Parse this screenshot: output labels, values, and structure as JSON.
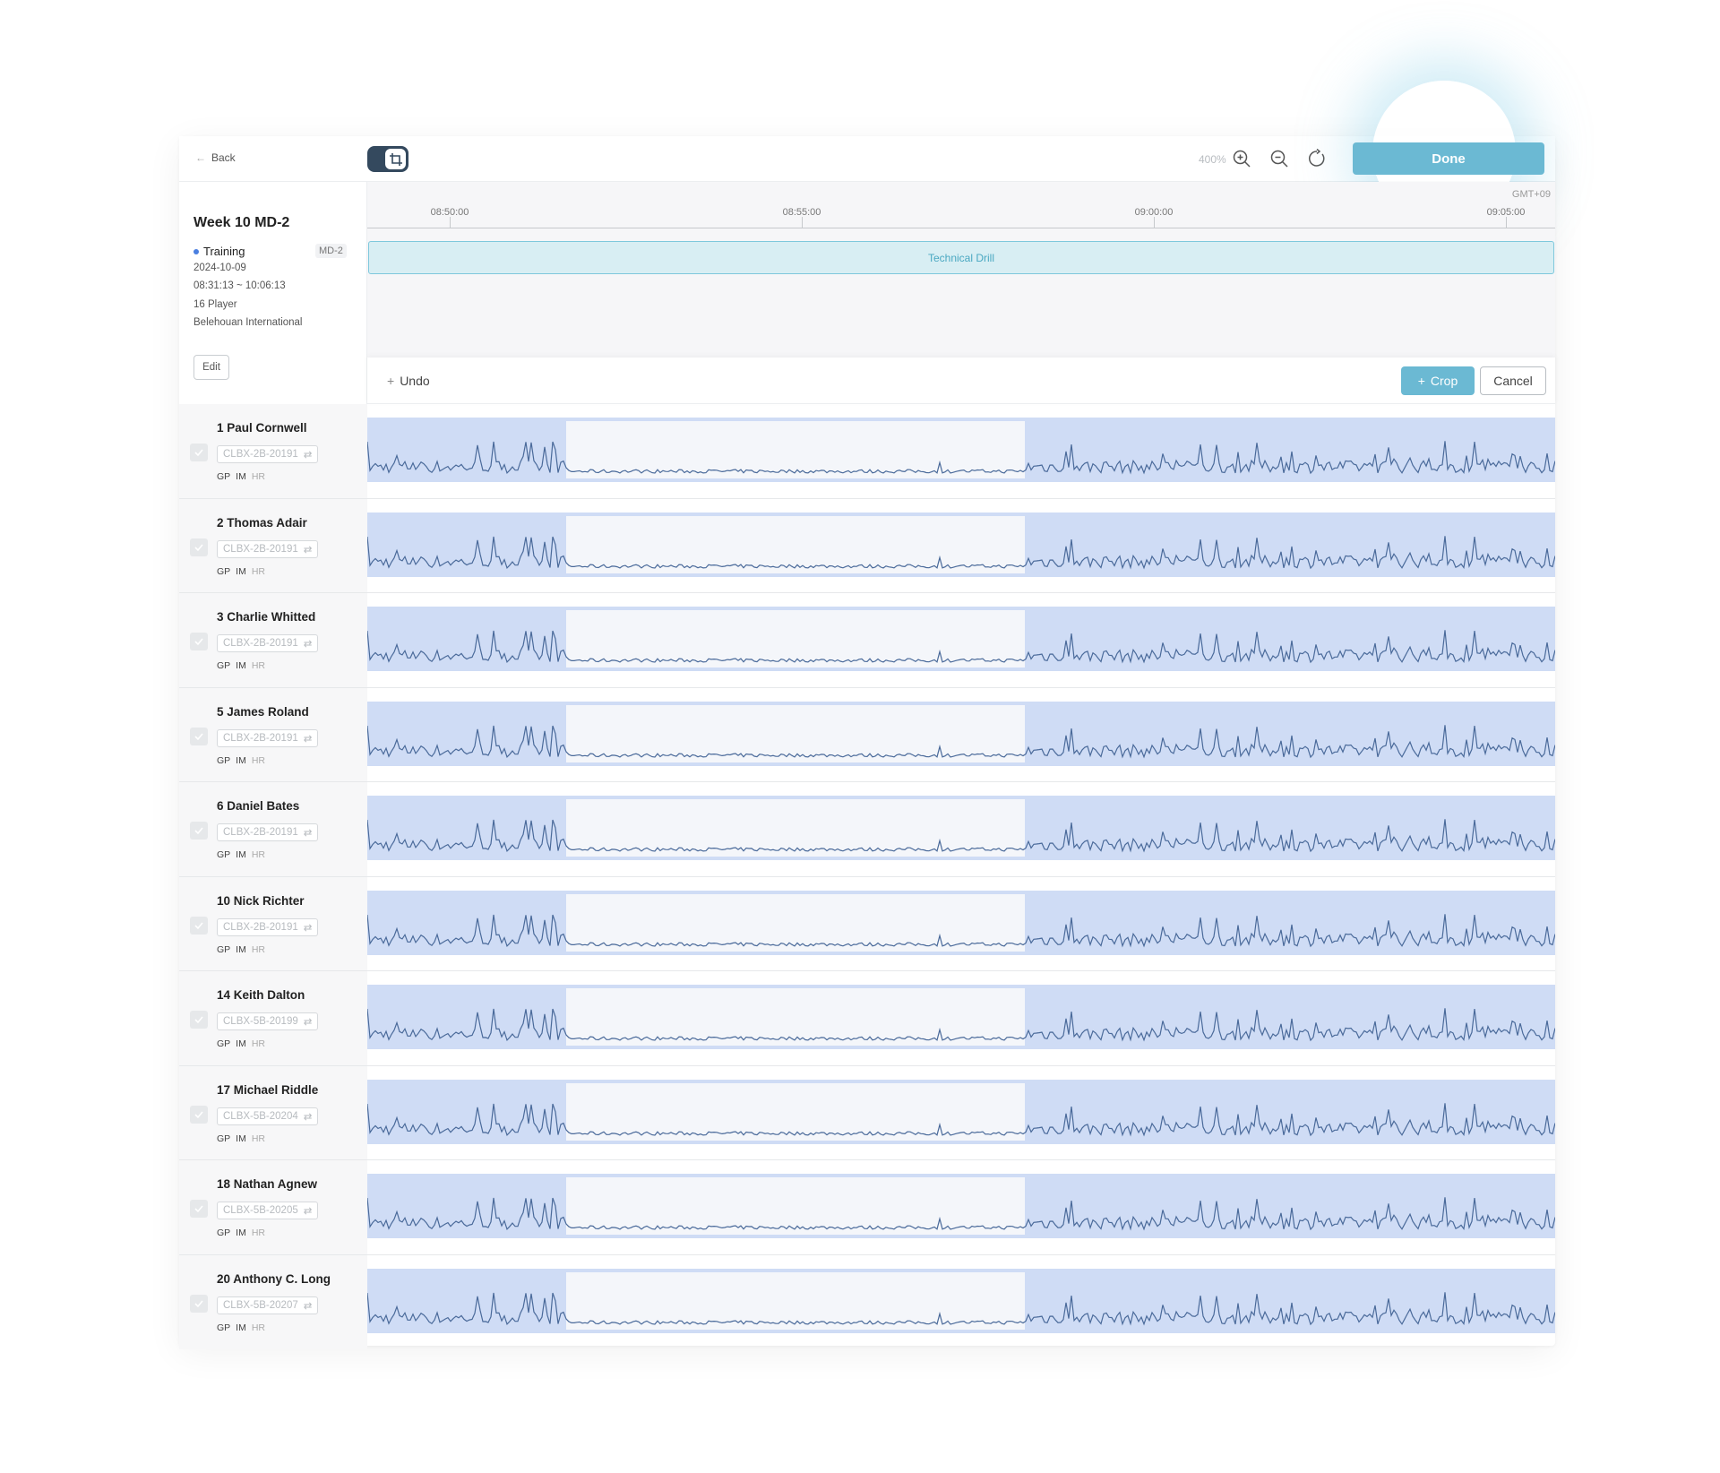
{
  "toolbar": {
    "back_label": "Back",
    "zoom_label": "400%",
    "done_label": "Done"
  },
  "session": {
    "title": "Week 10 MD-2",
    "type": "Training",
    "badge": "MD-2",
    "date": "2024-10-09",
    "time_range": "08:31:13 ~ 10:06:13",
    "players": "16 Player",
    "venue": "Belehouan International",
    "edit_label": "Edit"
  },
  "timeline": {
    "timezone": "GMT+09",
    "ticks": [
      "08:50:00",
      "08:55:00",
      "09:00:00",
      "09:05:00"
    ],
    "phase_label": "Technical Drill"
  },
  "cropbar": {
    "undo_label": "Undo",
    "crop_label": "Crop",
    "cancel_label": "Cancel"
  },
  "players": [
    {
      "name": "1 Paul Cornwell",
      "device": "CLBX-2B-20191"
    },
    {
      "name": "2 Thomas Adair",
      "device": "CLBX-2B-20191"
    },
    {
      "name": "3 Charlie Whitted",
      "device": "CLBX-2B-20191"
    },
    {
      "name": "5 James Roland",
      "device": "CLBX-2B-20191"
    },
    {
      "name": "6 Daniel Bates",
      "device": "CLBX-2B-20191"
    },
    {
      "name": "10 Nick Richter",
      "device": "CLBX-2B-20191"
    },
    {
      "name": "14 Keith Dalton",
      "device": "CLBX-5B-20199"
    },
    {
      "name": "17 Michael Riddle",
      "device": "CLBX-5B-20204"
    },
    {
      "name": "18 Nathan Agnew",
      "device": "CLBX-5B-20205"
    },
    {
      "name": "20 Anthony C. Long",
      "device": "CLBX-5B-20207"
    }
  ],
  "tags": {
    "gp": "GP",
    "im": "IM",
    "hr": "HR"
  },
  "colors": {
    "accent": "#6bb9d3",
    "toggle": "#34495e",
    "chart_fill": "#cfdcf5",
    "chart_line": "#4a6a9a",
    "phase_fill": "#d8eef3",
    "phase_border": "#7ec8dc"
  }
}
